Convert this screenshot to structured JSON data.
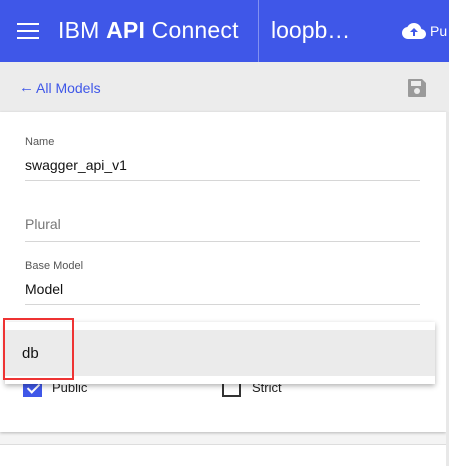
{
  "header": {
    "brand_prefix": "IBM",
    "brand_bold": "API",
    "brand_suffix": "Connect",
    "project": "loopb…",
    "publish_label": "Pu"
  },
  "toolbar": {
    "back_label": "All Models",
    "back_arrow": "←"
  },
  "form": {
    "name": {
      "label": "Name",
      "value": "swagger_api_v1"
    },
    "plural": {
      "placeholder": "Plural"
    },
    "base_model": {
      "label": "Base Model",
      "value": "Model"
    },
    "dropdown_option": "db",
    "public": {
      "label": "Public",
      "checked": true
    },
    "strict": {
      "label": "Strict",
      "checked": false
    }
  },
  "colors": {
    "accent": "#3f57e8",
    "highlight": "#e33333"
  }
}
